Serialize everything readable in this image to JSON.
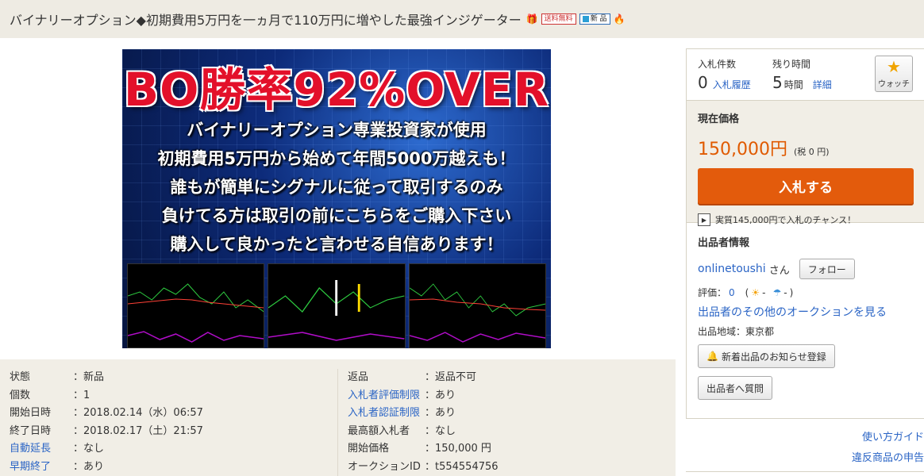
{
  "header": {
    "title": "バイナリーオプション◆初期費用5万円を一ヵ月で110万円に増やした最強インジゲーター",
    "badge_free_shipping": "送料無料",
    "badge_new": "新 品",
    "icon_names": [
      "gift-icon",
      "free-shipping-badge",
      "new-item-badge",
      "flame-icon"
    ]
  },
  "banner": {
    "headline": "BO勝率92%OVER",
    "lines": [
      "バイナリーオプション専業投資家が使用",
      "初期費用5万円から始めて年間5000万越えも！",
      "誰もが簡単にシグナルに従って取引するのみ",
      "負けてる方は取引の前にこちらをご購入下さい",
      "購入して良かったと言わせる自信あります！"
    ]
  },
  "specs": {
    "left": [
      {
        "label": "状態",
        "value": "：新品",
        "link": false
      },
      {
        "label": "個数",
        "value": "：1",
        "link": false
      },
      {
        "label": "開始日時",
        "value": "：2018.02.14（水）06:57",
        "link": false
      },
      {
        "label": "終了日時",
        "value": "：2018.02.17（土）21:57",
        "link": false
      },
      {
        "label": "自動延長",
        "value": "：なし",
        "link": true
      },
      {
        "label": "早期終了",
        "value": "：あり",
        "link": true
      }
    ],
    "right": [
      {
        "label": "返品",
        "value": "：返品不可",
        "link": false
      },
      {
        "label": "入札者評価制限",
        "value": "：あり",
        "link": true
      },
      {
        "label": "入札者認証制限",
        "value": "：あり",
        "link": true
      },
      {
        "label": "最高額入札者",
        "value": "：なし",
        "link": false
      },
      {
        "label": "開始価格",
        "value": "：150,000 円",
        "link": false
      },
      {
        "label": "オークションID",
        "value": "：t554554756",
        "link": false
      }
    ]
  },
  "stats": {
    "bids_label": "入札件数",
    "bids_count": "0",
    "bid_history_link": "入札履歴",
    "time_label": "残り時間",
    "time_value": "5",
    "time_unit": "時間",
    "detail_link": "詳細",
    "watch_label": "ウォッチ"
  },
  "price": {
    "label": "現在価格",
    "value": "150,000円",
    "tax": "(税 0 円)",
    "bid_button": "入札する",
    "chance_text": "実質145,000円で入札のチャンス！",
    "colors": {
      "price": "#e05a00",
      "button": "#e35b0c"
    }
  },
  "seller": {
    "heading": "出品者情報",
    "name": "onlinetoushi",
    "honorific": "さん",
    "follow_button": "フォロー",
    "rating_label": "評価：",
    "rating_value": "0",
    "rating_open": "(",
    "rating_good": "-",
    "rating_bad": "-",
    "rating_close": ")",
    "other_auctions": "出品者のその他のオークションを見る",
    "area": "出品地域：東京都",
    "notify_button": "新着出品のお知らせ登録",
    "ask_button": "出品者へ質問"
  },
  "footer_links": {
    "guide": "使い方ガイド",
    "report": "違反商品の申告"
  }
}
